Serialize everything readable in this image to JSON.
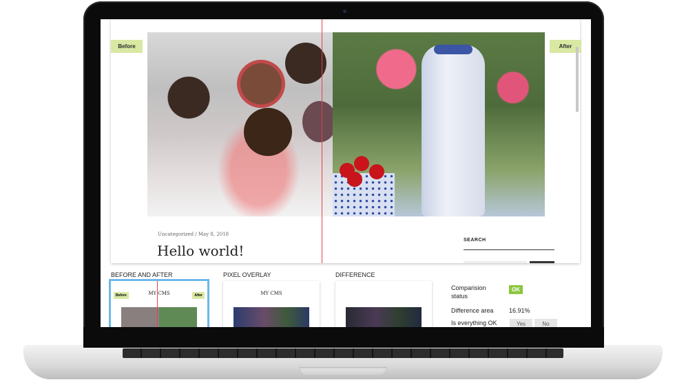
{
  "preview": {
    "before_tag": "Before",
    "after_tag": "After",
    "post_meta": {
      "category": "Uncategorized",
      "separator": "/",
      "date": "May 8, 2018"
    },
    "post_title": "Hello world!",
    "search_label": "SEARCH"
  },
  "panels": {
    "before_and_after": {
      "title": "BEFORE AND AFTER",
      "site_title": "MY CMS",
      "before_tag": "Before",
      "after_tag": "After"
    },
    "pixel_overlay": {
      "title": "PIXEL OVERLAY",
      "site_title": "MY CMS"
    },
    "difference": {
      "title": "DIFFERENCE"
    }
  },
  "stats": {
    "comparison_status_label_line1": "Comparision",
    "comparison_status_label_line2": "status",
    "comparison_status_value": "OK",
    "difference_area_label": "Difference area",
    "difference_area_value": "16.91%",
    "is_everything_ok_label": "Is everything OK",
    "yes_label": "Yes",
    "no_label": "No"
  },
  "colors": {
    "tag_bg": "#d9e8a3",
    "divider": "#e4404a",
    "ok_badge": "#8cc63f",
    "selected_outline": "#6cb8e8"
  }
}
